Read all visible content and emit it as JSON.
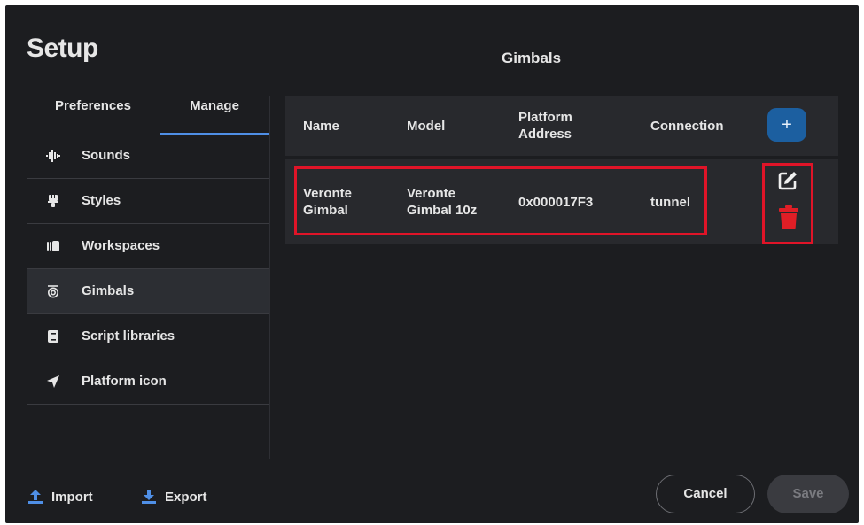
{
  "dialog": {
    "title": "Setup",
    "section_title": "Gimbals"
  },
  "tabs": [
    {
      "label": "Preferences",
      "selected": false
    },
    {
      "label": "Manage",
      "selected": true
    }
  ],
  "menu": [
    {
      "label": "Sounds",
      "icon": "sound-wave-icon",
      "active": false
    },
    {
      "label": "Styles",
      "icon": "paint-brush-icon",
      "active": false
    },
    {
      "label": "Workspaces",
      "icon": "workspaces-icon",
      "active": false
    },
    {
      "label": "Gimbals",
      "icon": "gimbal-camera-icon",
      "active": true
    },
    {
      "label": "Script libraries",
      "icon": "book-icon",
      "active": false
    },
    {
      "label": "Platform icon",
      "icon": "navigation-arrow-icon",
      "active": false
    }
  ],
  "table": {
    "columns": [
      "Name",
      "Model",
      "Platform Address",
      "Connection"
    ],
    "add_label": "+",
    "rows": [
      {
        "name": "Veronte Gimbal",
        "model": "Veronte Gimbal 10z",
        "address": "0x000017F3",
        "connection": "tunnel"
      }
    ]
  },
  "footer": {
    "import_label": "Import",
    "export_label": "Export",
    "cancel_label": "Cancel",
    "save_label": "Save"
  },
  "colors": {
    "background": "#1c1d20",
    "panel": "#28292d",
    "accent": "#1c5fa0",
    "tab_underline": "#4f8fe6",
    "highlight": "#e01428",
    "delete": "#e01e26"
  }
}
